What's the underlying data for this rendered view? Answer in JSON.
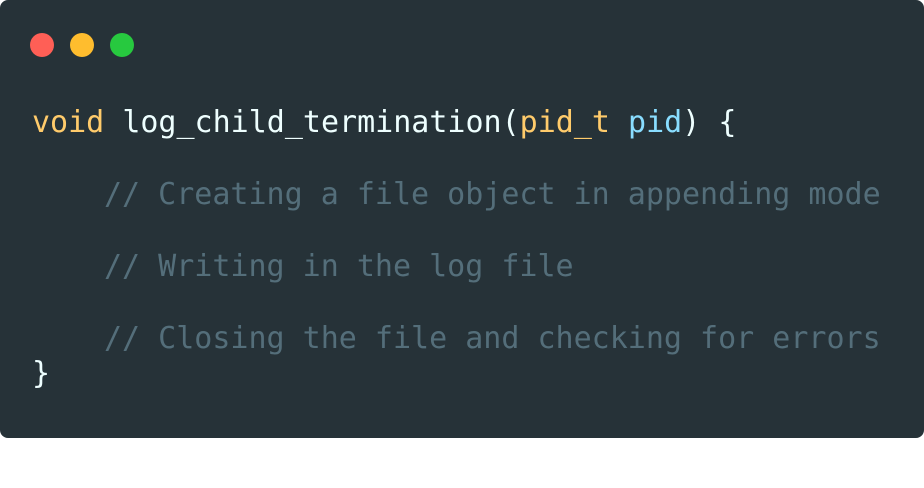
{
  "window": {
    "controls": [
      {
        "name": "close",
        "color": "#ff5f56"
      },
      {
        "name": "minimize",
        "color": "#ffbd2e"
      },
      {
        "name": "maximize",
        "color": "#27c93f"
      }
    ]
  },
  "code": {
    "signature": {
      "return_type": "void",
      "function_name": "log_child_termination",
      "open_paren": "(",
      "param_type": "pid_t",
      "param_name": "pid",
      "close": ") {"
    },
    "comments": [
      "// Creating a file object in appending mode",
      "// Writing in the log file",
      "// Closing the file and checking for errors"
    ],
    "closing_brace": "}"
  }
}
